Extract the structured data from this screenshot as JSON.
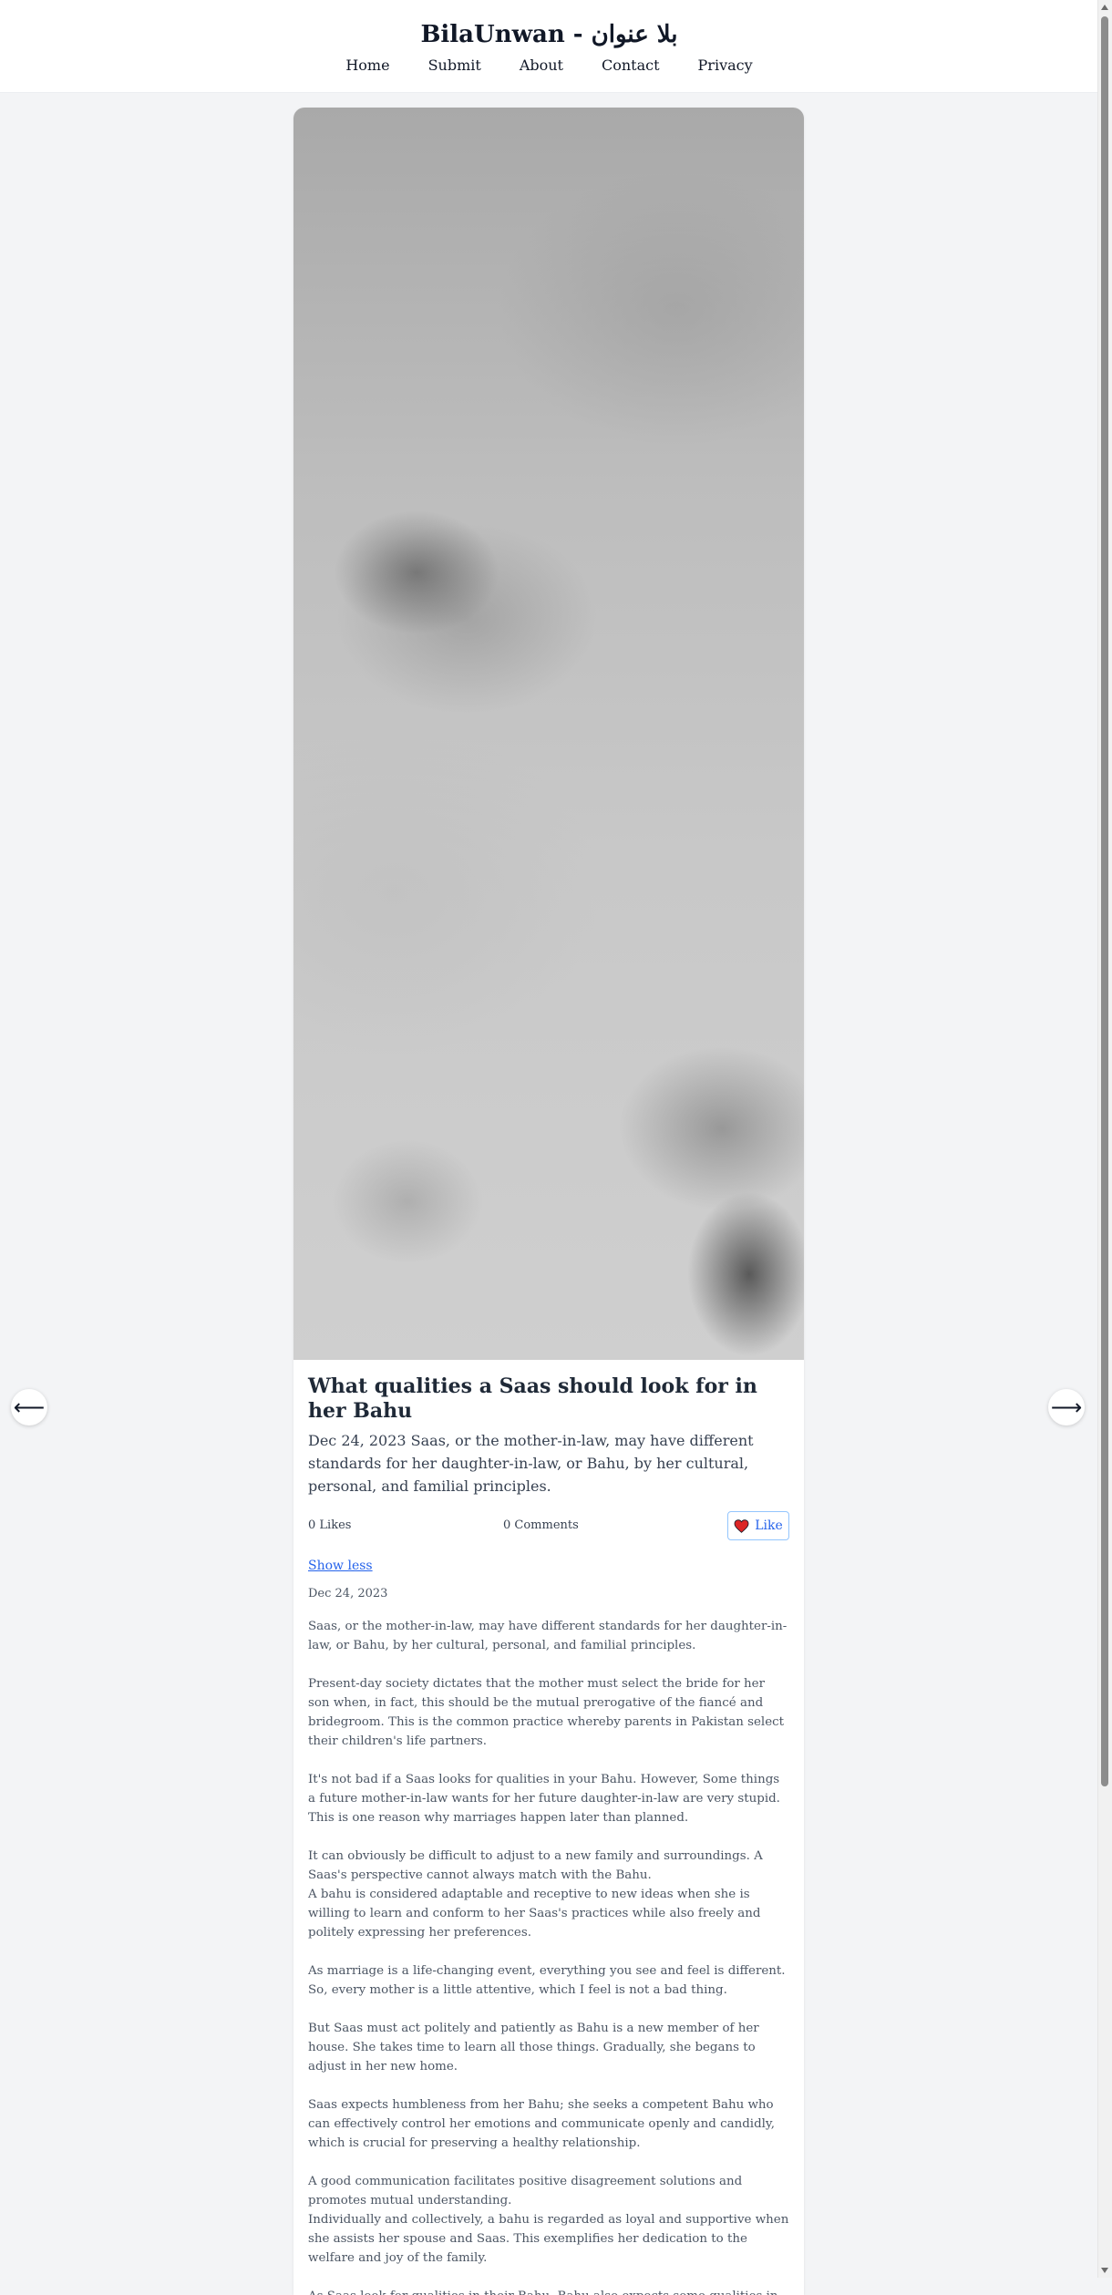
{
  "site": {
    "title": "BilaUnwan - بلا عنوان"
  },
  "nav": {
    "items": [
      "Home",
      "Submit",
      "About",
      "Contact",
      "Privacy"
    ]
  },
  "post": {
    "title": "What qualities a Saas should look for in her Bahu",
    "excerpt": "Dec 24, 2023 Saas, or the mother-in-law, may have different standards for her daughter-in-law, or Bahu, by her cultural, personal, and familial principles.",
    "likes": "0 Likes",
    "comments": "0 Comments",
    "like_label": "Like",
    "show_less": "Show less",
    "date": "Dec 24, 2023",
    "body": [
      "Saas, or the mother-in-law, may have different standards for her daughter-in-law, or Bahu, by her cultural, personal, and familial principles.",
      "Present-day society dictates that the mother must select the bride for her son when, in fact, this should be the mutual prerogative of the fiancé and bridegroom. This is the common practice whereby parents in Pakistan select their children's life partners.",
      "It's not bad if a Saas looks for qualities in your Bahu. However, Some things a future mother-in-law wants for her future daughter-in-law are very stupid. This is one reason why marriages happen later than planned.",
      "It can obviously be difficult to adjust to a new family and surroundings. A Saas's perspective cannot always match with the Bahu.\nA bahu is considered adaptable and receptive to new ideas when she is willing to learn and conform to her Saas's practices while also freely and politely expressing her preferences.",
      "As marriage is a life-changing event, everything you see and feel is different. So, every mother is a little attentive, which I feel is not a bad thing.",
      "But Saas must act politely and patiently as Bahu is a new member of her house. She takes time to learn all those things. Gradually, she begans to adjust in her new home.",
      "Saas expects humbleness from her Bahu; she seeks a competent Bahu who can effectively control her emotions and communicate openly and candidly, which is crucial for preserving a healthy relationship.",
      "A good communication facilitates positive disagreement solutions and promotes mutual understanding.\nIndividually and collectively, a bahu is regarded as loyal and supportive when she assists her spouse and Saas. This exemplifies her dedication to the welfare and joy of the family.",
      "As Saas look for qualities in their Bahu, Bahu also expects some qualities in their Saas. Every mother should respect that, too. Both are two different individuals and"
    ]
  },
  "arrows": {
    "prev": "⟵",
    "next": "⟶"
  },
  "colors": {
    "accent": "#2563eb",
    "heart": "#dc2626",
    "background": "#f3f4f6"
  }
}
